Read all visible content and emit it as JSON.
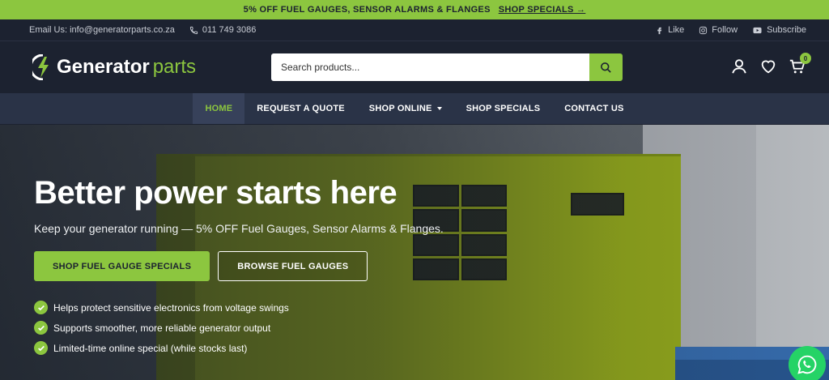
{
  "promo": {
    "text": "5% OFF FUEL GAUGES, SENSOR ALARMS & FLANGES",
    "link": "SHOP SPECIALS →"
  },
  "info": {
    "email": "Email Us: info@generatorparts.co.za",
    "phone": "011 749 3086",
    "social": [
      {
        "label": "Like",
        "icon": "facebook-icon"
      },
      {
        "label": "Follow",
        "icon": "instagram-icon"
      },
      {
        "label": "Subscribe",
        "icon": "youtube-icon"
      }
    ]
  },
  "header": {
    "logo_main": "Generator",
    "logo_accent": "parts",
    "search_placeholder": "Search products...",
    "cart_count": "0"
  },
  "nav": {
    "items": [
      {
        "label": "HOME",
        "active": true
      },
      {
        "label": "REQUEST A QUOTE"
      },
      {
        "label": "SHOP ONLINE",
        "dropdown": true
      },
      {
        "label": "SHOP SPECIALS"
      },
      {
        "label": "CONTACT US"
      }
    ]
  },
  "hero": {
    "title": "Better power starts here",
    "subtitle": "Keep your generator running — 5% OFF Fuel Gauges, Sensor Alarms & Flanges.",
    "cta_primary": "SHOP FUEL GAUGE SPECIALS",
    "cta_secondary": "BROWSE FUEL GAUGES",
    "bullets": [
      "Helps protect sensitive electronics from voltage swings",
      "Supports smoother, more reliable generator output",
      "Limited-time online special (while stocks last)"
    ]
  },
  "colors": {
    "accent": "#8cc63f",
    "dark": "#1c2230",
    "nav": "#2a3347"
  }
}
